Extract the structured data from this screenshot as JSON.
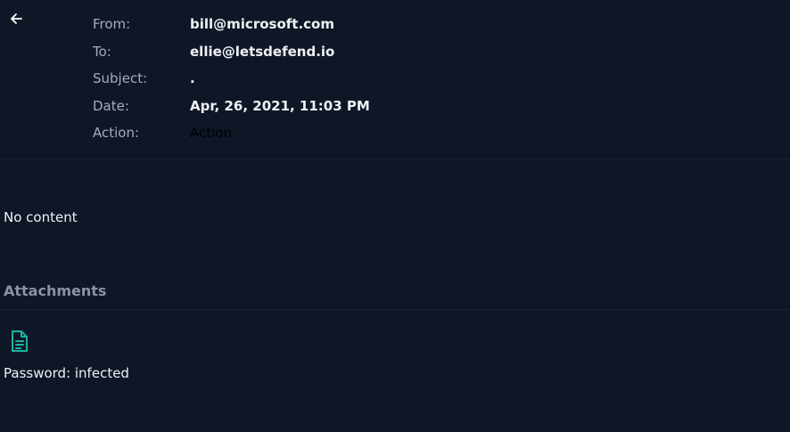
{
  "header": {
    "back_icon": "arrow-left-icon"
  },
  "email": {
    "from_label": "From:",
    "from_value": "bill@microsoft.com",
    "to_label": "To:",
    "to_value": "ellie@letsdefend.io",
    "subject_label": "Subject:",
    "subject_value": ".",
    "date_label": "Date:",
    "date_value": "Apr, 26, 2021, 11:03 PM",
    "action_label": "Action:",
    "action_value": "Action"
  },
  "body": {
    "text": "No content"
  },
  "attachments": {
    "title": "Attachments",
    "file_icon": "file-document-icon",
    "icon_color": "#19b3a0",
    "note": "Password: infected"
  }
}
